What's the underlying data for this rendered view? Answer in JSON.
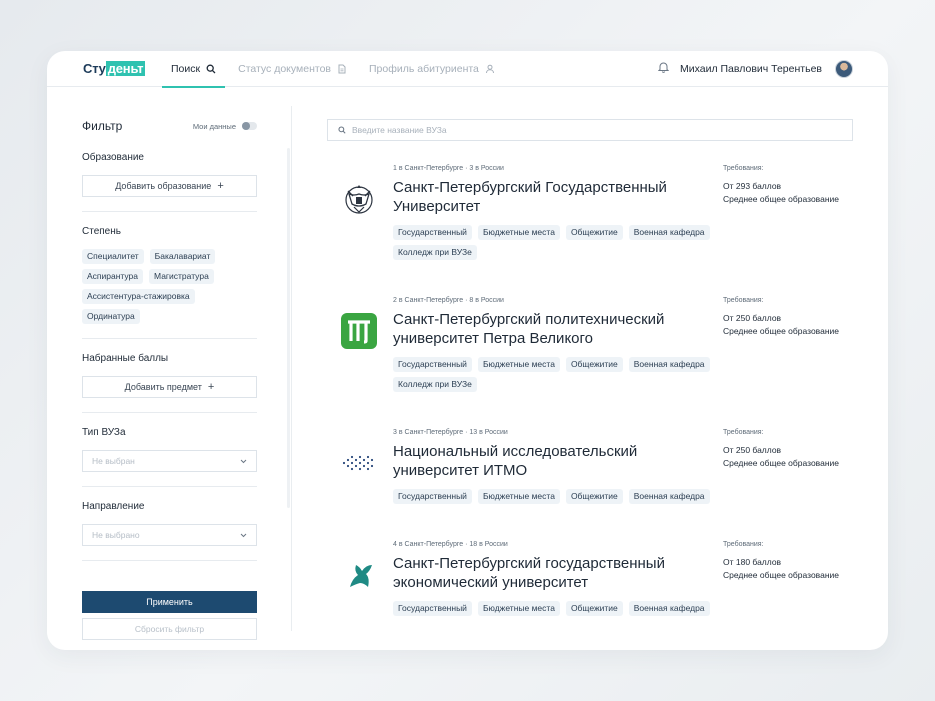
{
  "header": {
    "logo_a": "Сту",
    "logo_b": "деньт",
    "nav": [
      {
        "label": "Поиск",
        "icon": "search-icon",
        "active": true
      },
      {
        "label": "Статус документов",
        "icon": "document-icon",
        "active": false
      },
      {
        "label": "Профиль абитуриента",
        "icon": "user-icon",
        "active": false
      }
    ],
    "user_name": "Михаил Павлович Терентьев"
  },
  "filter": {
    "title": "Фильтр",
    "my_data_label": "Мои данные",
    "education_label": "Образование",
    "add_education": "Добавить образование",
    "degree_label": "Степень",
    "degrees": [
      "Специалитет",
      "Бакалавариат",
      "Аспирантура",
      "Магистратура",
      "Ассистентура-стажировка",
      "Ординатура"
    ],
    "scores_label": "Набранные баллы",
    "add_subject": "Добавить предмет",
    "type_label": "Тип ВУЗа",
    "type_value": "Не выбран",
    "direction_label": "Направление",
    "direction_value": "Не выбрано",
    "apply": "Применить",
    "reset": "Сбросить фильтр"
  },
  "search": {
    "placeholder": "Введите название ВУЗа"
  },
  "universities": [
    {
      "rank": "1 в Санкт-Петербурге · 3 в России",
      "name": "Санкт-Петербургский Государственный Университет",
      "tags": [
        "Государственный",
        "Бюджетные места",
        "Общежитие",
        "Военная кафедра",
        "Колледж при ВУЗе"
      ],
      "req_label": "Требования:",
      "req_score": "От 293 баллов",
      "req_edu": "Среднее общее образование"
    },
    {
      "rank": "2 в Санкт-Петербурге · 8 в России",
      "name": "Санкт-Петербургский политехнический университет Петра Великого",
      "tags": [
        "Государственный",
        "Бюджетные места",
        "Общежитие",
        "Военная кафедра",
        "Колледж при ВУЗе"
      ],
      "req_label": "Требования:",
      "req_score": "От 250 баллов",
      "req_edu": "Среднее общее образование"
    },
    {
      "rank": "3 в Санкт-Петербурге · 13 в России",
      "name": "Национальный исследовательский университет ИТМО",
      "tags": [
        "Государственный",
        "Бюджетные места",
        "Общежитие",
        "Военная кафедра"
      ],
      "req_label": "Требования:",
      "req_score": "От 250 баллов",
      "req_edu": "Среднее общее образование"
    },
    {
      "rank": "4 в Санкт-Петербурге · 18 в России",
      "name": "Санкт-Петербургский государственный экономический университет",
      "tags": [
        "Государственный",
        "Бюджетные места",
        "Общежитие",
        "Военная кафедра"
      ],
      "req_label": "Требования:",
      "req_score": "От 180 баллов",
      "req_edu": "Среднее общее образование"
    }
  ],
  "colors": {
    "accent": "#2fc2b0",
    "primary": "#1d4a70",
    "chip_bg": "#eef3f7"
  }
}
